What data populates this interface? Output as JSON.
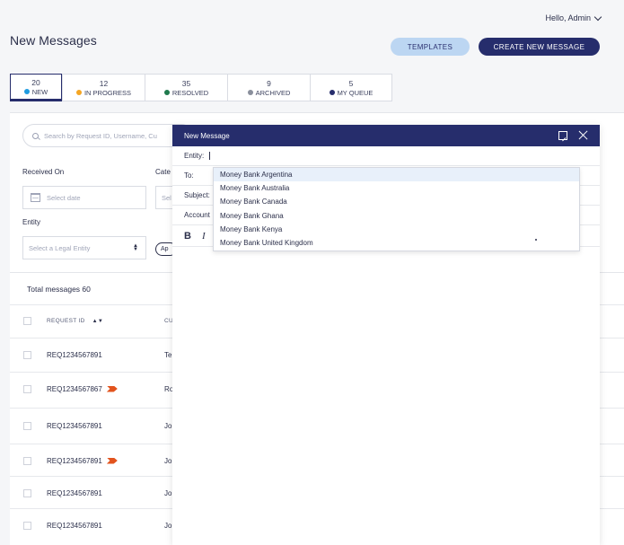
{
  "header": {
    "greeting": "Hello, Admin",
    "page_title": "New Messages"
  },
  "actions": {
    "templates_label": "TEMPLATES",
    "create_label": "CREATE NEW MESSAGE"
  },
  "tabs": [
    {
      "count": "20",
      "label": "NEW",
      "color": "#1e9be0"
    },
    {
      "count": "12",
      "label": "IN PROGRESS",
      "color": "#f5a623"
    },
    {
      "count": "35",
      "label": "RESOLVED",
      "color": "#1f7a4d"
    },
    {
      "count": "9",
      "label": "ARCHIVED",
      "color": "#8a8f9c"
    },
    {
      "count": "5",
      "label": "MY QUEUE",
      "color": "#262d6c"
    }
  ],
  "filters": {
    "search_placeholder": "Search by Request ID, Username, Cu",
    "received_on_label": "Received On",
    "date_placeholder": "Select date",
    "category_label": "Cate",
    "category_placeholder": "Sel",
    "entity_label": "Entity",
    "entity_placeholder": "Select a Legal Entity",
    "apply_label": "Ap"
  },
  "table": {
    "total": "Total messages 60",
    "col_request_id": "REQUEST ID",
    "col_second": "CU",
    "rows": [
      {
        "id": "REQ1234567891",
        "c2": "Te",
        "flag": false
      },
      {
        "id": "REQ1234567867",
        "c2": "Ro",
        "flag": true
      },
      {
        "id": "REQ1234567891",
        "c2": "Jo",
        "flag": false
      },
      {
        "id": "REQ1234567891",
        "c2": "Jo",
        "flag": true
      },
      {
        "id": "REQ1234567891",
        "c2": "Jo",
        "flag": false
      },
      {
        "id": "REQ1234567891",
        "c2": "Jo",
        "flag": false
      }
    ]
  },
  "modal": {
    "title": "New Message",
    "entity_label": "Entity:",
    "to_label": "To:",
    "subject_label": "Subject:",
    "account_label": "Account",
    "bold": "B",
    "italic": "I"
  },
  "dropdown": {
    "options": [
      "Money Bank Argentina",
      "Money Bank Australia",
      "Money Bank Canada",
      "Money Bank Ghana",
      "Money Bank Kenya",
      "Money Bank United Kingdom"
    ]
  }
}
